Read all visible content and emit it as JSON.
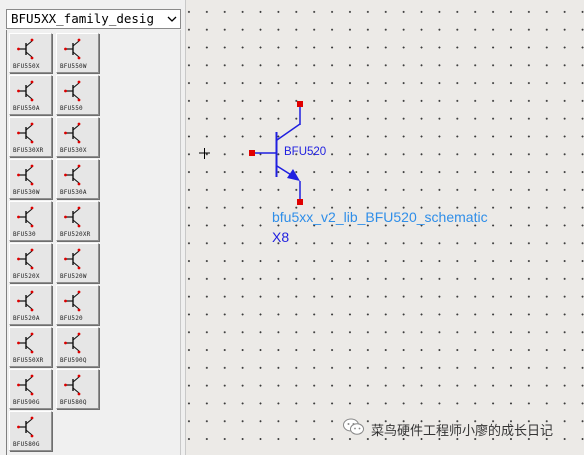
{
  "sidebar": {
    "library_select": {
      "value": "BFU5XX_family_desig"
    },
    "parts": [
      {
        "label": "BFU550X"
      },
      {
        "label": "BFU550W"
      },
      {
        "label": "BFU550A"
      },
      {
        "label": "BFU550"
      },
      {
        "label": "BFU530XR"
      },
      {
        "label": "BFU530X"
      },
      {
        "label": "BFU530W"
      },
      {
        "label": "BFU530A"
      },
      {
        "label": "BFU530"
      },
      {
        "label": "BFU520XR"
      },
      {
        "label": "BFU520X"
      },
      {
        "label": "BFU520W"
      },
      {
        "label": "BFU520A"
      },
      {
        "label": "BFU520"
      },
      {
        "label": "BFU550XR"
      },
      {
        "label": "BFU590Q"
      },
      {
        "label": "BFU590G"
      },
      {
        "label": "BFU580Q"
      },
      {
        "label": "BFU580G"
      }
    ]
  },
  "schematic": {
    "part_value": "BFU520",
    "library_name": "bfu5xx_v2_lib_BFU520_schematic",
    "reference": "X8",
    "colors": {
      "symbol": "#1f1fe0",
      "pin": "#e00000",
      "library_text": "#2f8ee8",
      "grid_dot": "#3a3a3a"
    }
  },
  "watermark": {
    "text": "菜鸟硬件工程师小廖的成长日记",
    "icon": "wechat-icon"
  }
}
